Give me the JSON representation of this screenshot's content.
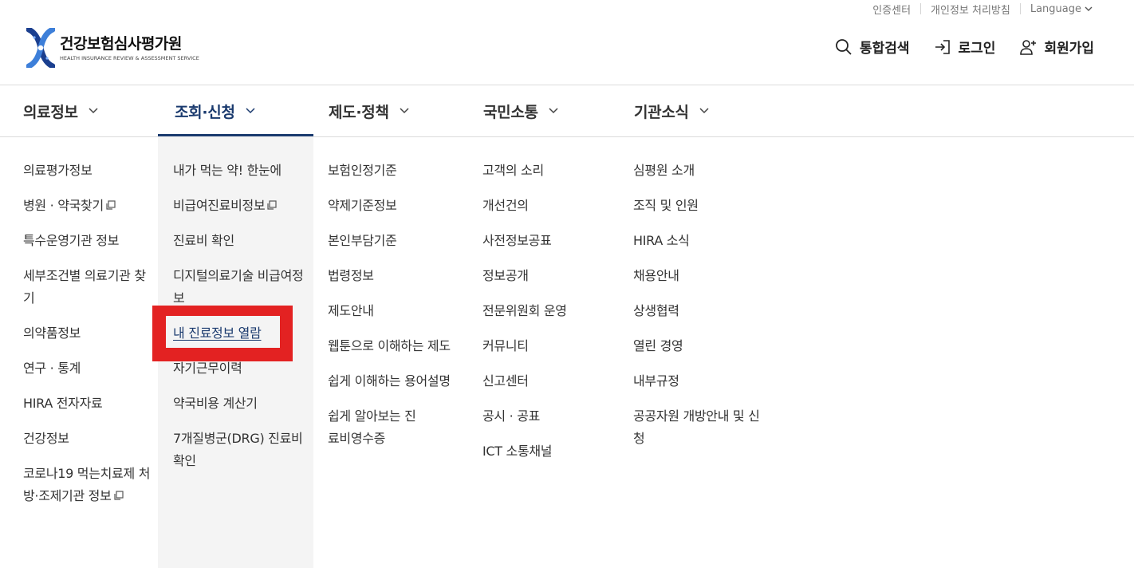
{
  "utility": {
    "cert_center": "인증센터",
    "privacy": "개인정보 처리방침",
    "language": "Language"
  },
  "logo": {
    "title": "건강보험심사평가원",
    "subtitle": "HEALTH INSURANCE REVIEW & ASSESSMENT SERVICE"
  },
  "header": {
    "search": "통합검색",
    "login": "로그인",
    "signup": "회원가입"
  },
  "gnb": [
    "의료정보",
    "조회·신청",
    "제도·정책",
    "국민소통",
    "기관소식"
  ],
  "menu": {
    "col1": [
      "의료평가정보",
      "병원 · 약국찾기",
      "특수운영기관 정보",
      "세부조건별 의료기관 찾기",
      "의약품정보",
      "연구 · 통계",
      "HIRA 전자자료",
      "건강정보",
      "코로나19 먹는치료제 처방·조제기관 정보"
    ],
    "col2": [
      "내가 먹는 약! 한눈에",
      "비급여진료비정보",
      "진료비 확인",
      "디지털의료기술 비급여정보",
      "내 진료정보 열람",
      "자기근무이력",
      "약국비용 계산기",
      "7개질병군(DRG) 진료비 확인"
    ],
    "col3": [
      "보험인정기준",
      "약제기준정보",
      "본인부담기준",
      "법령정보",
      "제도안내",
      "웹툰으로 이해하는 제도",
      "쉽게 이해하는 용어설명",
      "쉽게 알아보는 진료비영수증"
    ],
    "col4": [
      "고객의 소리",
      "개선건의",
      "사전정보공표",
      "정보공개",
      "전문위원회 운영",
      "커뮤니티",
      "신고센터",
      "공시 · 공표",
      "ICT 소통채널"
    ],
    "col5": [
      "심평원 소개",
      "조직 및 인원",
      "HIRA 소식",
      "채용안내",
      "상생협력",
      "열린 경영",
      "내부규정",
      "공공자원 개방안내 및 신청"
    ]
  },
  "colors": {
    "accent": "#1a3a6e",
    "highlight": "#e32222",
    "active_bg": "#f4f4f4"
  }
}
